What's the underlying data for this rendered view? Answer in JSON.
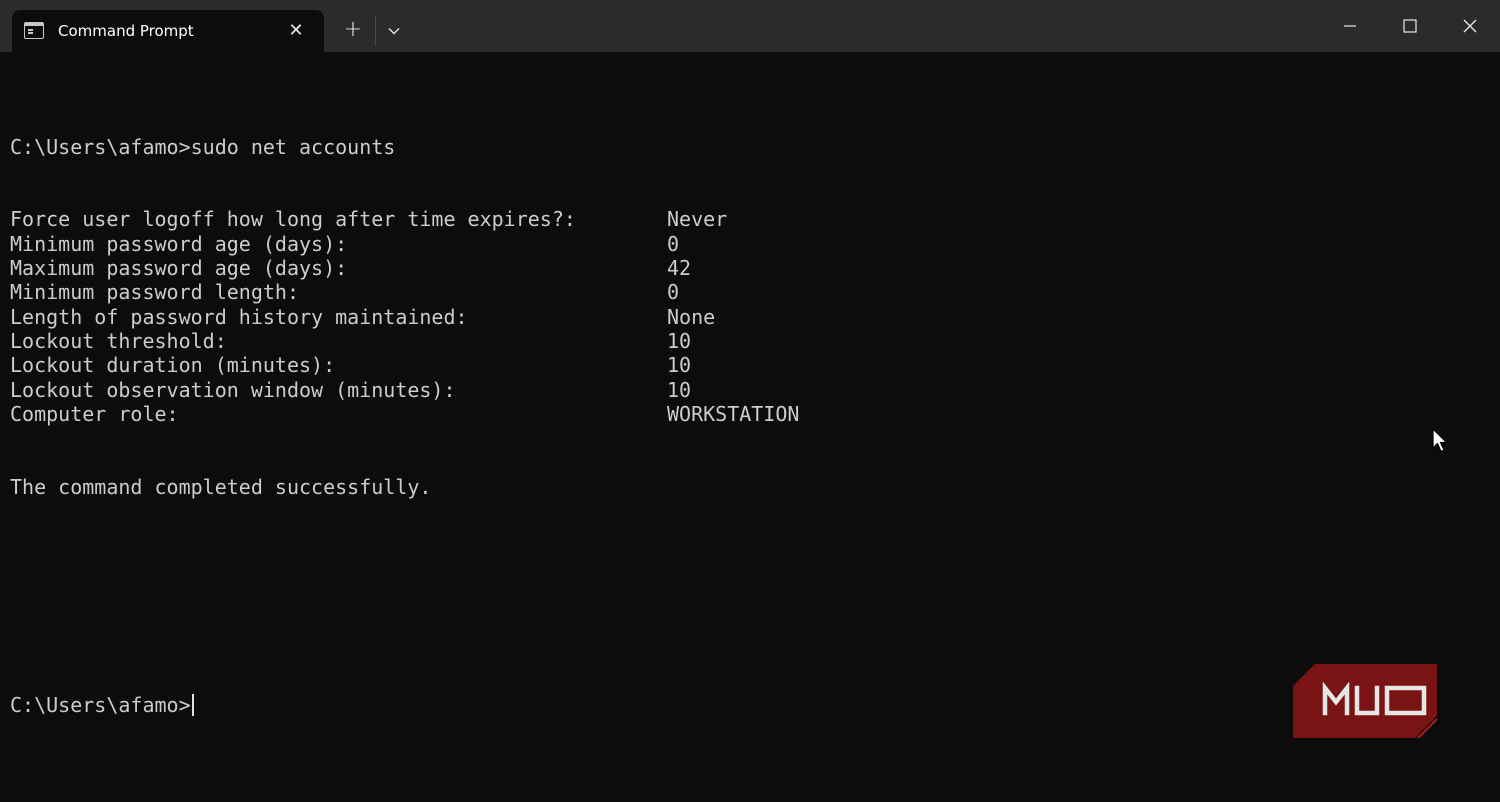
{
  "window": {
    "tab_title": "Command Prompt",
    "tab_close_label": "✕",
    "new_tab_label": "+",
    "tab_icon": "terminal-icon",
    "dropdown_icon": "chevron-down-icon",
    "controls": [
      "minimize-icon",
      "maximize-icon",
      "close-icon"
    ]
  },
  "terminal": {
    "command_line": "C:\\Users\\afamo>sudo net accounts",
    "rows": [
      {
        "key": "Force user logoff how long after time expires?:",
        "value": "Never"
      },
      {
        "key": "Minimum password age (days):",
        "value": "0"
      },
      {
        "key": "Maximum password age (days):",
        "value": "42"
      },
      {
        "key": "Minimum password length:",
        "value": "0"
      },
      {
        "key": "Length of password history maintained:",
        "value": "None"
      },
      {
        "key": "Lockout threshold:",
        "value": "10"
      },
      {
        "key": "Lockout duration (minutes):",
        "value": "10"
      },
      {
        "key": "Lockout observation window (minutes):",
        "value": "10"
      },
      {
        "key": "Computer role:",
        "value": "WORKSTATION"
      }
    ],
    "status_line": "The command completed successfully.",
    "prompt": "C:\\Users\\afamo>"
  },
  "watermark": {
    "text": "MUO",
    "color": "#7a1414"
  },
  "colors": {
    "titlebar": "#2b2b2b",
    "background": "#0c0c0c",
    "text": "#cccccc"
  }
}
